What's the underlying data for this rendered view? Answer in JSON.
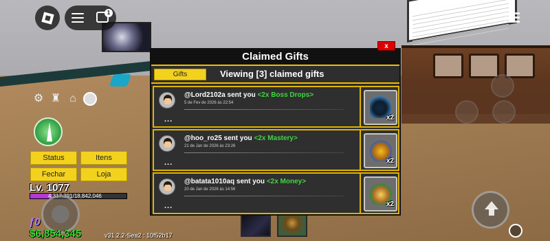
{
  "top_bar": {
    "chat_badge_count": "1"
  },
  "hud": {
    "buttons": [
      "Status",
      "Itens",
      "Fechar",
      "Loja"
    ],
    "level": "Lv. 1077",
    "xp_text": "4,317,391/18,842,046",
    "xp_fraction": 0.23,
    "fragments": "ƒ0",
    "money": "$6,854,345",
    "version": "v31.2.2-Sea2 : 10f52b17",
    "icons": [
      "gear-icon",
      "crew-icon",
      "home-icon",
      "profile-icon"
    ]
  },
  "dialog": {
    "title": "Claimed Gifts",
    "close_label": "x",
    "tab_label": "Gifts",
    "viewing_text": "Viewing [3] claimed gifts",
    "gifts": [
      {
        "sender_text": "@Lord2102a sent you",
        "item_text": "<2x Boss Drops>",
        "date": "5 de Fev de 2026 às 22:54",
        "dots": "...",
        "badge": "x2",
        "icon": "boss-drops-icon"
      },
      {
        "sender_text": "@hoo_ro25 sent you",
        "item_text": "<2x Mastery>",
        "date": "21 de Jan de 2026 às 23:26",
        "dots": "...",
        "badge": "x2",
        "icon": "mastery-icon"
      },
      {
        "sender_text": "@batata1010aq sent you",
        "item_text": "<2x Money>",
        "date": "20 de Jan de 2026 às 14:56",
        "dots": "...",
        "badge": "x2",
        "icon": "money-chest-icon"
      }
    ]
  },
  "colors": {
    "accent_yellow": "#f3d21e",
    "gift_item_green": "#3ed83e",
    "money_green": "#38e038",
    "xp_purple": "#b238d8",
    "close_red": "#dd0000"
  }
}
